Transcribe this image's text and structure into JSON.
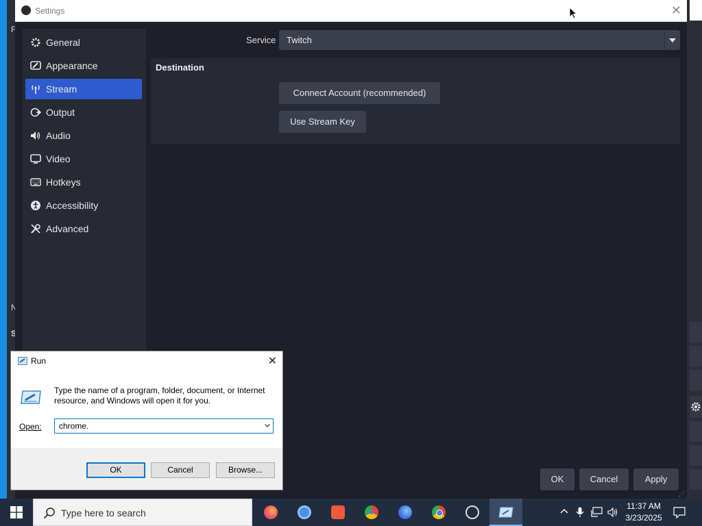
{
  "settings_window": {
    "title": "Settings",
    "close_glyph": "✕",
    "sidebar": {
      "items": [
        {
          "label": "General",
          "icon": "gear-icon",
          "active": false
        },
        {
          "label": "Appearance",
          "icon": "appearance-icon",
          "active": false
        },
        {
          "label": "Stream",
          "icon": "stream-antenna-icon",
          "active": true
        },
        {
          "label": "Output",
          "icon": "output-icon",
          "active": false
        },
        {
          "label": "Audio",
          "icon": "speaker-icon",
          "active": false
        },
        {
          "label": "Video",
          "icon": "monitor-icon",
          "active": false
        },
        {
          "label": "Hotkeys",
          "icon": "keyboard-icon",
          "active": false
        },
        {
          "label": "Accessibility",
          "icon": "accessibility-icon",
          "active": false
        },
        {
          "label": "Advanced",
          "icon": "wrench-icon",
          "active": false
        }
      ]
    },
    "service": {
      "label": "Service",
      "value": "Twitch"
    },
    "destination": {
      "header": "Destination",
      "connect_button": "Connect Account (recommended)",
      "stream_key_button": "Use Stream Key"
    },
    "footer": {
      "ok": "OK",
      "cancel": "Cancel",
      "apply": "Apply"
    }
  },
  "run_dialog": {
    "title": "Run",
    "close_glyph": "✕",
    "description": "Type the name of a program, folder, document, or Internet resource, and Windows will open it for you.",
    "open_label": "Open:",
    "open_value": "chrome.",
    "buttons": {
      "ok": "OK",
      "cancel": "Cancel",
      "browse": "Browse..."
    }
  },
  "taskbar": {
    "search_placeholder": "Type here to search",
    "time": "11:37 AM",
    "date": "3/23/2025",
    "apps": [
      "firefox-icon",
      "chromium-icon",
      "red-app-icon",
      "chrome-b-icon",
      "firefox-dev-icon",
      "chrome-icon",
      "obs-icon",
      "run-icon"
    ]
  },
  "background": {
    "left_fragments": [
      "F",
      "S",
      "N"
    ],
    "colors": {
      "accent": "#2f5bd1",
      "panel": "#272a33",
      "window_bg": "#1e1f28",
      "taskbar": "#202d3f"
    }
  }
}
